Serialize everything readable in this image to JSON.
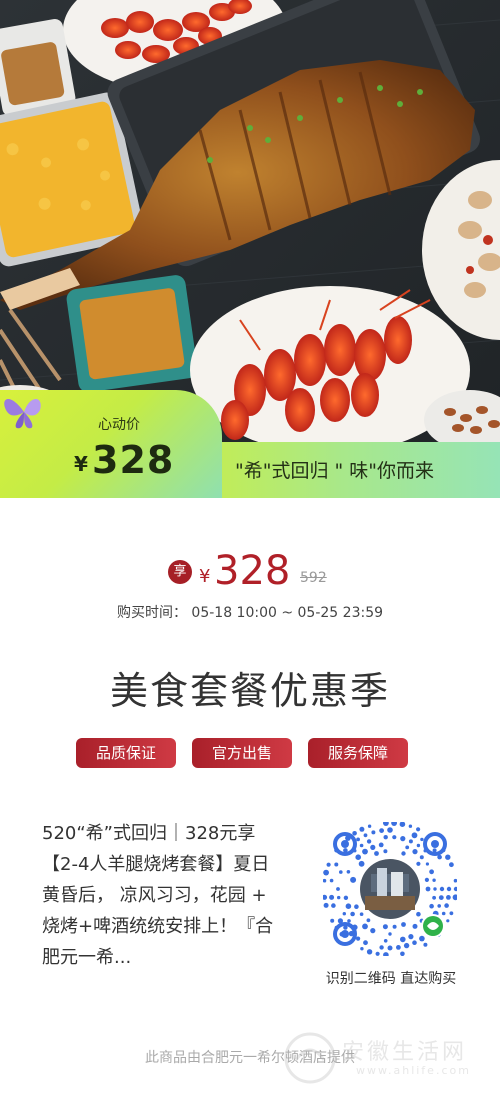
{
  "hero": {
    "price_label": "心动价",
    "currency": "¥",
    "price": "328",
    "slogan": "\"希\"式回归 \" 味\"你而来"
  },
  "promo": {
    "badge": "享",
    "currency": "¥",
    "price": "328",
    "original_price": "592",
    "time_label": "购买时间：",
    "time_range": "05-18 10:00 ~ 05-25 23:59"
  },
  "title": "美食套餐优惠季",
  "badges": [
    "品质保证",
    "官方出售",
    "服务保障"
  ],
  "description": "520“希”式回归｜328元享【2-4人羊腿烧烤套餐】夏日黄昏后， 凉风习习，花园 + 烧烤+啤酒统统安排上！『合肥元一希...",
  "qr": {
    "caption": "识别二维码 直达购买"
  },
  "footer": {
    "provider": "此商品由合肥元一希尔顿酒店提供"
  },
  "watermark": {
    "text": "安徽生活网",
    "sub": "www.ahlife.com"
  },
  "colors": {
    "accent_red": "#b02028",
    "lime": "#c8ee4a",
    "mint": "#96e4b6"
  }
}
